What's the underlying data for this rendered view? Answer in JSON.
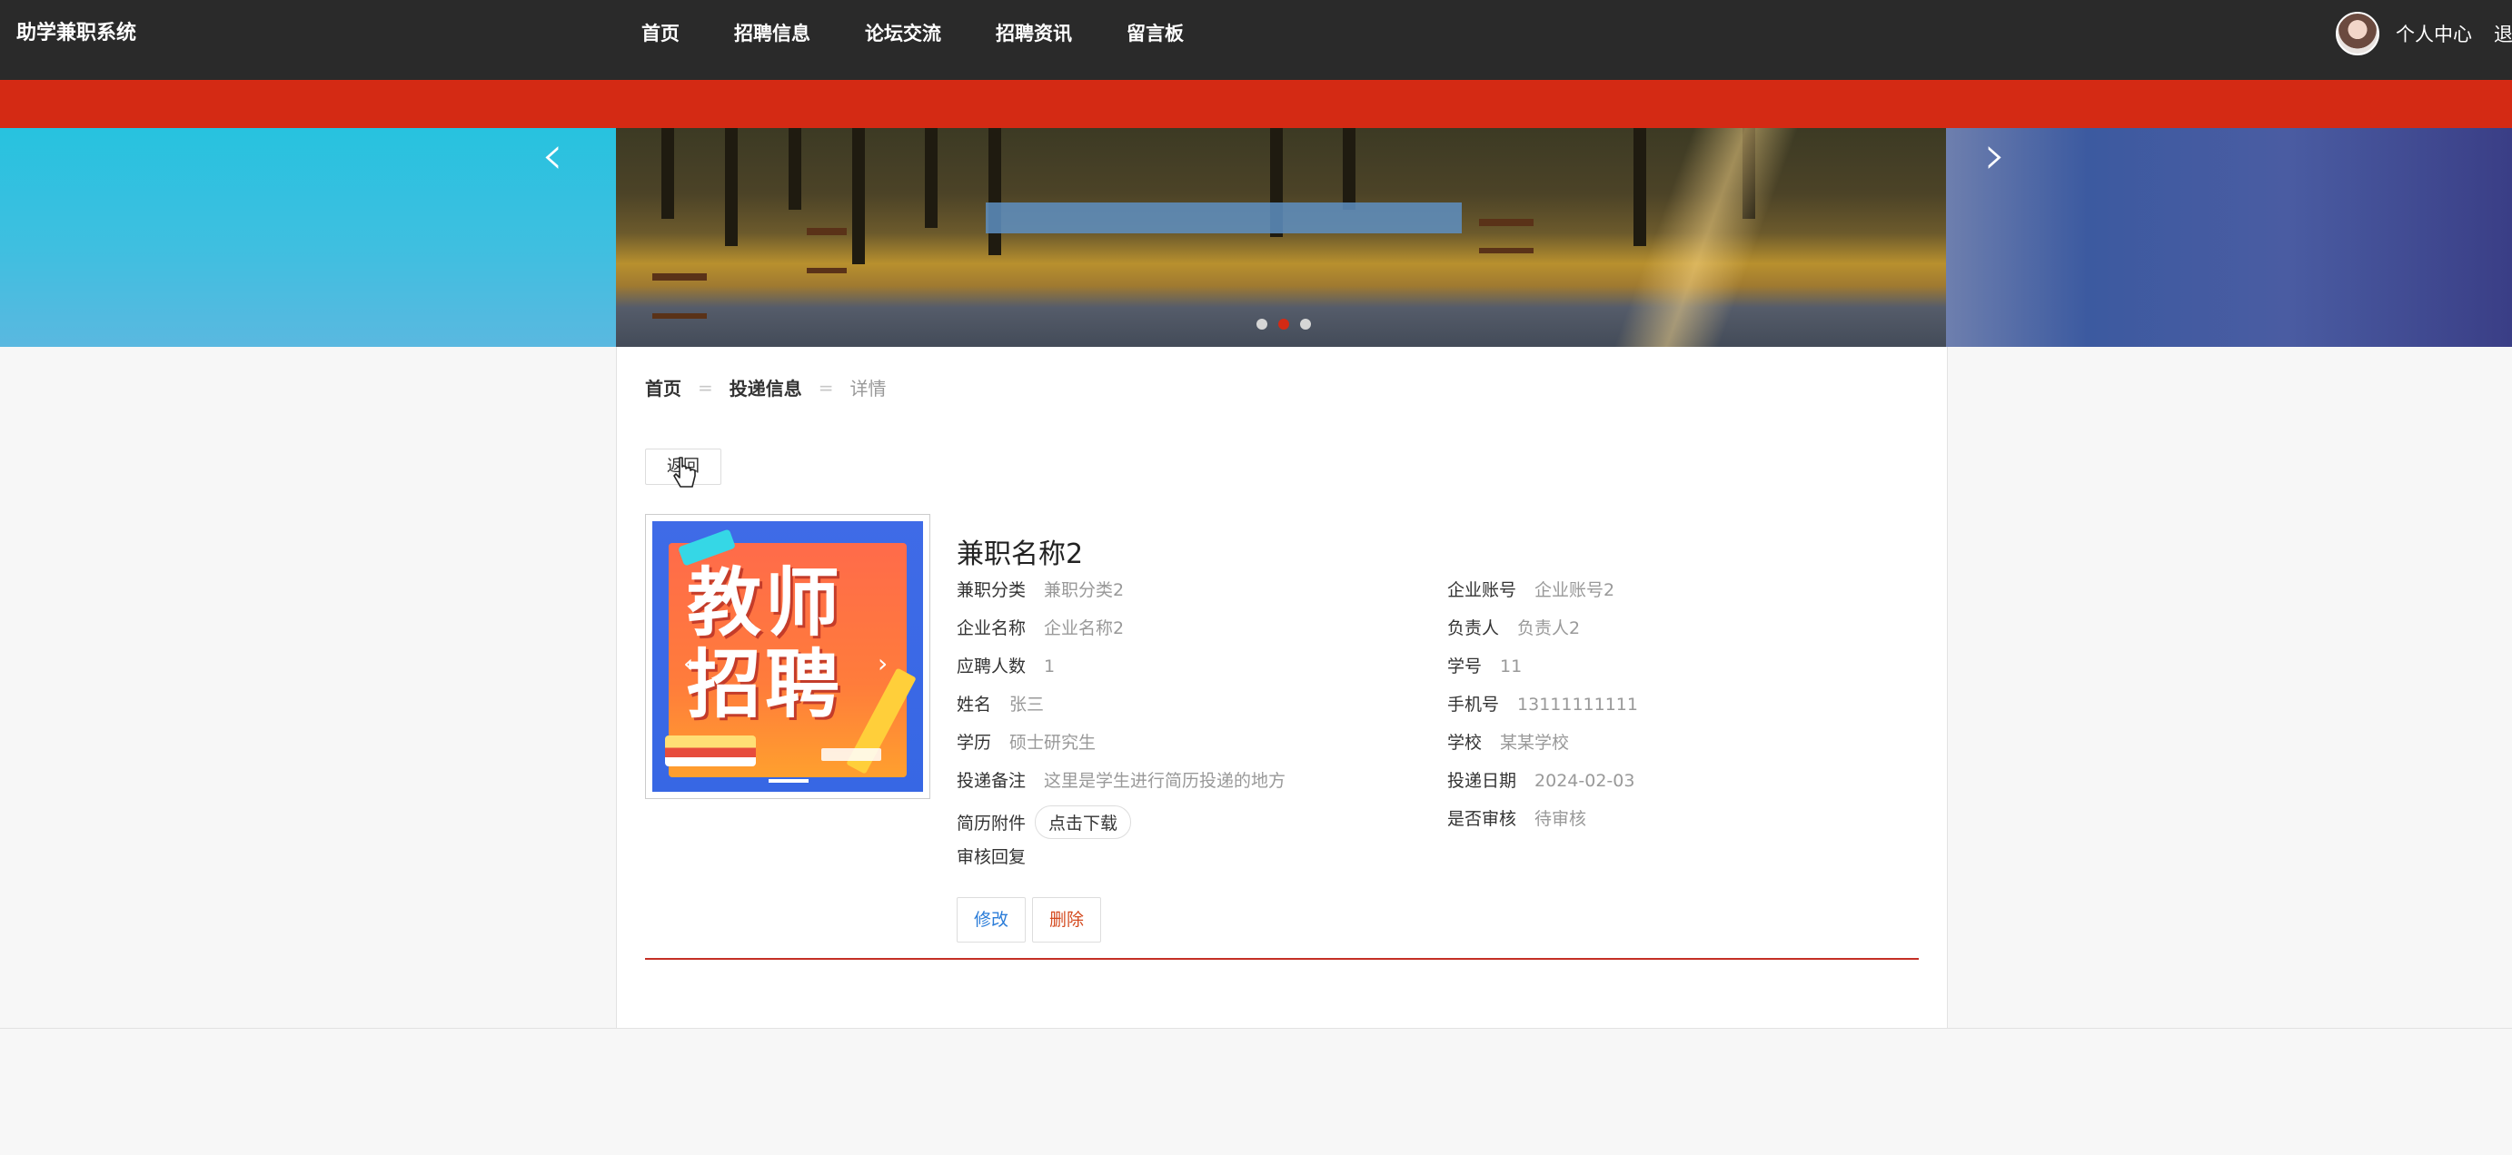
{
  "brand": "助学兼职系统",
  "nav": [
    "首页",
    "招聘信息",
    "论坛交流",
    "招聘资讯",
    "留言板"
  ],
  "user": {
    "center": "个人中心",
    "logout": "退出"
  },
  "banner": {
    "dots": 3,
    "active_dot": 2
  },
  "breadcrumb": {
    "home": "首页",
    "section": "投递信息",
    "current": "详情",
    "separator": "="
  },
  "back_label": "返回",
  "detail": {
    "title": "兼职名称2",
    "poster_text": "教师招聘",
    "left_fields": [
      {
        "k": "兼职分类",
        "v": "兼职分类2"
      },
      {
        "k": "企业名称",
        "v": "企业名称2"
      },
      {
        "k": "应聘人数",
        "v": "1"
      },
      {
        "k": "姓名",
        "v": "张三"
      },
      {
        "k": "学历",
        "v": "硕士研究生"
      },
      {
        "k": "投递备注",
        "v": "这里是学生进行简历投递的地方"
      },
      {
        "k": "简历附件",
        "v": ""
      },
      {
        "k": "审核回复",
        "v": ""
      }
    ],
    "right_fields": [
      {
        "k": "企业账号",
        "v": "企业账号2"
      },
      {
        "k": "负责人",
        "v": "负责人2"
      },
      {
        "k": "学号",
        "v": "11"
      },
      {
        "k": "手机号",
        "v": "13111111111"
      },
      {
        "k": "学校",
        "v": "某某学校"
      },
      {
        "k": "投递日期",
        "v": "2024-02-03"
      },
      {
        "k": "是否审核",
        "v": "待审核"
      }
    ],
    "download_label": "点击下载",
    "edit_label": "修改",
    "delete_label": "删除"
  }
}
